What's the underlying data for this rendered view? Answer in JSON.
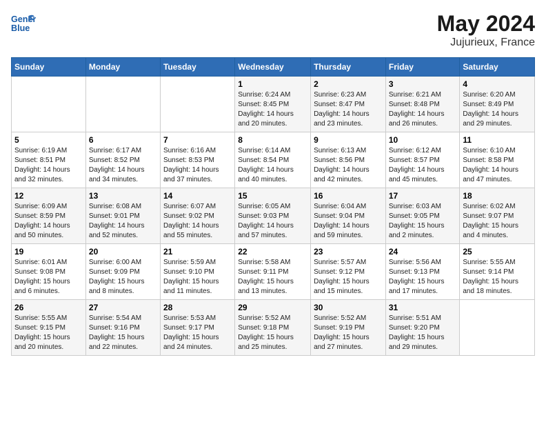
{
  "header": {
    "logo_line1": "General",
    "logo_line2": "Blue",
    "month_year": "May 2024",
    "location": "Jujurieux, France"
  },
  "days_of_week": [
    "Sunday",
    "Monday",
    "Tuesday",
    "Wednesday",
    "Thursday",
    "Friday",
    "Saturday"
  ],
  "weeks": [
    [
      {
        "day": "",
        "info": ""
      },
      {
        "day": "",
        "info": ""
      },
      {
        "day": "",
        "info": ""
      },
      {
        "day": "1",
        "info": "Sunrise: 6:24 AM\nSunset: 8:45 PM\nDaylight: 14 hours\nand 20 minutes."
      },
      {
        "day": "2",
        "info": "Sunrise: 6:23 AM\nSunset: 8:47 PM\nDaylight: 14 hours\nand 23 minutes."
      },
      {
        "day": "3",
        "info": "Sunrise: 6:21 AM\nSunset: 8:48 PM\nDaylight: 14 hours\nand 26 minutes."
      },
      {
        "day": "4",
        "info": "Sunrise: 6:20 AM\nSunset: 8:49 PM\nDaylight: 14 hours\nand 29 minutes."
      }
    ],
    [
      {
        "day": "5",
        "info": "Sunrise: 6:19 AM\nSunset: 8:51 PM\nDaylight: 14 hours\nand 32 minutes."
      },
      {
        "day": "6",
        "info": "Sunrise: 6:17 AM\nSunset: 8:52 PM\nDaylight: 14 hours\nand 34 minutes."
      },
      {
        "day": "7",
        "info": "Sunrise: 6:16 AM\nSunset: 8:53 PM\nDaylight: 14 hours\nand 37 minutes."
      },
      {
        "day": "8",
        "info": "Sunrise: 6:14 AM\nSunset: 8:54 PM\nDaylight: 14 hours\nand 40 minutes."
      },
      {
        "day": "9",
        "info": "Sunrise: 6:13 AM\nSunset: 8:56 PM\nDaylight: 14 hours\nand 42 minutes."
      },
      {
        "day": "10",
        "info": "Sunrise: 6:12 AM\nSunset: 8:57 PM\nDaylight: 14 hours\nand 45 minutes."
      },
      {
        "day": "11",
        "info": "Sunrise: 6:10 AM\nSunset: 8:58 PM\nDaylight: 14 hours\nand 47 minutes."
      }
    ],
    [
      {
        "day": "12",
        "info": "Sunrise: 6:09 AM\nSunset: 8:59 PM\nDaylight: 14 hours\nand 50 minutes."
      },
      {
        "day": "13",
        "info": "Sunrise: 6:08 AM\nSunset: 9:01 PM\nDaylight: 14 hours\nand 52 minutes."
      },
      {
        "day": "14",
        "info": "Sunrise: 6:07 AM\nSunset: 9:02 PM\nDaylight: 14 hours\nand 55 minutes."
      },
      {
        "day": "15",
        "info": "Sunrise: 6:05 AM\nSunset: 9:03 PM\nDaylight: 14 hours\nand 57 minutes."
      },
      {
        "day": "16",
        "info": "Sunrise: 6:04 AM\nSunset: 9:04 PM\nDaylight: 14 hours\nand 59 minutes."
      },
      {
        "day": "17",
        "info": "Sunrise: 6:03 AM\nSunset: 9:05 PM\nDaylight: 15 hours\nand 2 minutes."
      },
      {
        "day": "18",
        "info": "Sunrise: 6:02 AM\nSunset: 9:07 PM\nDaylight: 15 hours\nand 4 minutes."
      }
    ],
    [
      {
        "day": "19",
        "info": "Sunrise: 6:01 AM\nSunset: 9:08 PM\nDaylight: 15 hours\nand 6 minutes."
      },
      {
        "day": "20",
        "info": "Sunrise: 6:00 AM\nSunset: 9:09 PM\nDaylight: 15 hours\nand 8 minutes."
      },
      {
        "day": "21",
        "info": "Sunrise: 5:59 AM\nSunset: 9:10 PM\nDaylight: 15 hours\nand 11 minutes."
      },
      {
        "day": "22",
        "info": "Sunrise: 5:58 AM\nSunset: 9:11 PM\nDaylight: 15 hours\nand 13 minutes."
      },
      {
        "day": "23",
        "info": "Sunrise: 5:57 AM\nSunset: 9:12 PM\nDaylight: 15 hours\nand 15 minutes."
      },
      {
        "day": "24",
        "info": "Sunrise: 5:56 AM\nSunset: 9:13 PM\nDaylight: 15 hours\nand 17 minutes."
      },
      {
        "day": "25",
        "info": "Sunrise: 5:55 AM\nSunset: 9:14 PM\nDaylight: 15 hours\nand 18 minutes."
      }
    ],
    [
      {
        "day": "26",
        "info": "Sunrise: 5:55 AM\nSunset: 9:15 PM\nDaylight: 15 hours\nand 20 minutes."
      },
      {
        "day": "27",
        "info": "Sunrise: 5:54 AM\nSunset: 9:16 PM\nDaylight: 15 hours\nand 22 minutes."
      },
      {
        "day": "28",
        "info": "Sunrise: 5:53 AM\nSunset: 9:17 PM\nDaylight: 15 hours\nand 24 minutes."
      },
      {
        "day": "29",
        "info": "Sunrise: 5:52 AM\nSunset: 9:18 PM\nDaylight: 15 hours\nand 25 minutes."
      },
      {
        "day": "30",
        "info": "Sunrise: 5:52 AM\nSunset: 9:19 PM\nDaylight: 15 hours\nand 27 minutes."
      },
      {
        "day": "31",
        "info": "Sunrise: 5:51 AM\nSunset: 9:20 PM\nDaylight: 15 hours\nand 29 minutes."
      },
      {
        "day": "",
        "info": ""
      }
    ]
  ]
}
